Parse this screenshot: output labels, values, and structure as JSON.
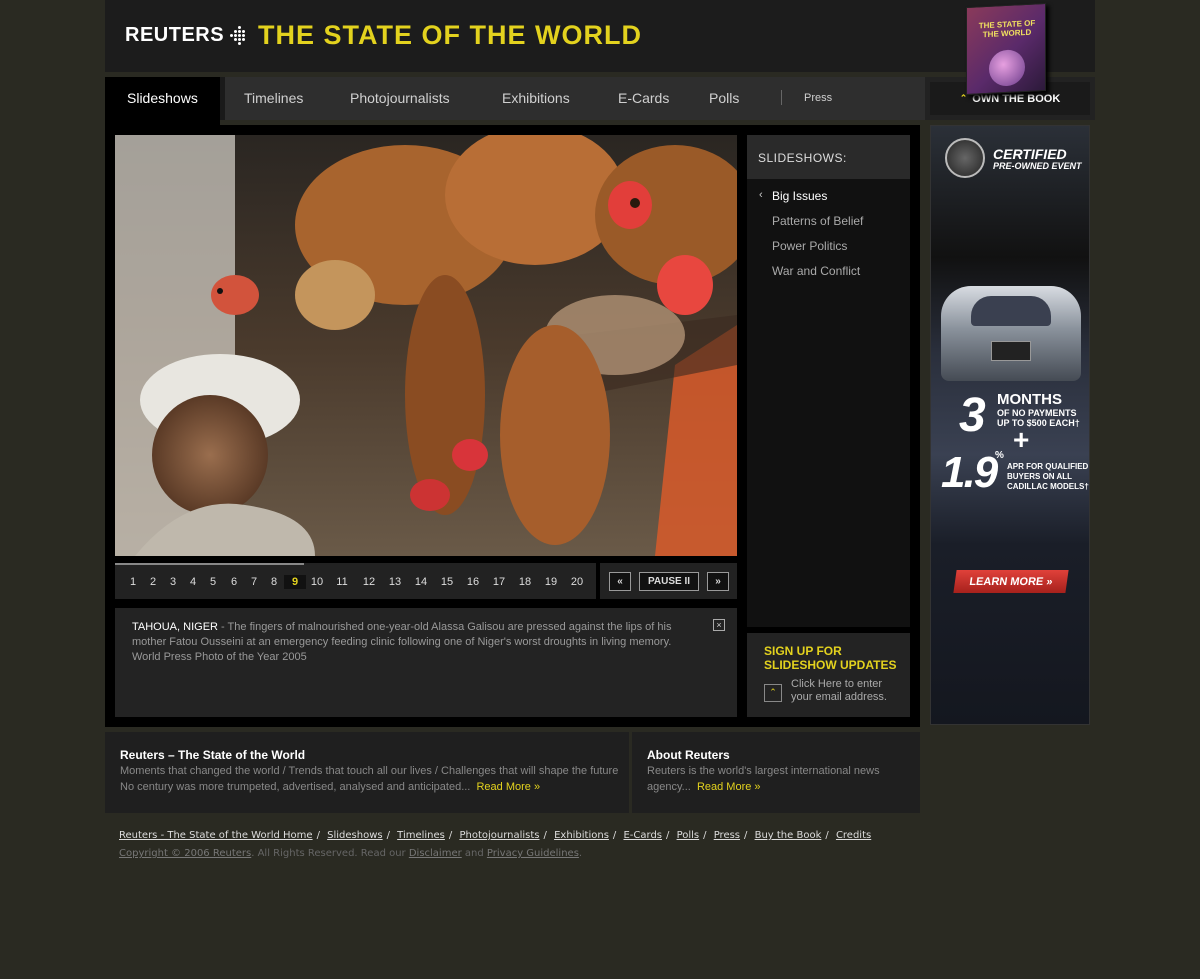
{
  "header": {
    "logo_text": "REUTERS",
    "title": "THE STATE OF THE WORLD",
    "book_cover_text": "THE STATE OF THE WORLD",
    "own_book_label": "OWN THE BOOK"
  },
  "nav": {
    "items": [
      "Slideshows",
      "Timelines",
      "Photojournalists",
      "Exhibitions",
      "E-Cards",
      "Polls"
    ],
    "press_label": "Press",
    "active": "Slideshows"
  },
  "slideshow": {
    "pages": [
      "1",
      "2",
      "3",
      "4",
      "5",
      "6",
      "7",
      "8",
      "9",
      "10",
      "11",
      "12",
      "13",
      "14",
      "15",
      "16",
      "17",
      "18",
      "19",
      "20"
    ],
    "current_page": "9",
    "prev_label": "prev",
    "pause_label": "PAUSE II",
    "next_label": "next",
    "caption_location": "TAHOUA, NIGER",
    "caption_text": " - The fingers of malnourished one-year-old Alassa Galisou are pressed against the lips of his mother Fatou Ousseini at an emergency feeding clinic following one of Niger's worst droughts in living memory.",
    "caption_credit": "World Press Photo of the Year 2005"
  },
  "sidebar": {
    "header": "SLIDESHOWS:",
    "items": [
      "Big Issues",
      "Patterns of Belief",
      "Power Politics",
      "War and Conflict"
    ],
    "active": "Big Issues",
    "signup_title": "SIGN UP FOR SLIDESHOW UPDATES",
    "signup_text": "Click Here to enter your email address."
  },
  "ad": {
    "certified": "CERTIFIED",
    "event": "PRE-OWNED EVENT",
    "big_number": "3",
    "months": "MONTHS",
    "no_payments": "OF NO PAYMENTS UP TO $500 EACH†",
    "plus": "+",
    "rate": "1.9",
    "pct": "%",
    "apr": "APR FOR QUALIFIED BUYERS ON ALL CADILLAC MODELS†",
    "learn_more": "LEARN MORE »"
  },
  "info": {
    "left_title": "Reuters – The State of the World",
    "left_text_1": "Moments that changed the world / Trends that touch all our lives / Challenges that will shape the future",
    "left_text_2": "No century was more trumpeted, advertised, analysed and anticipated...",
    "right_title": "About Reuters",
    "right_text": "Reuters is the world's largest international news agency...",
    "read_more": "Read More »"
  },
  "footer": {
    "links": [
      "Reuters - The State of the World Home",
      "Slideshows",
      "Timelines",
      "Photojournalists",
      "Exhibitions",
      "E-Cards",
      "Polls",
      "Press",
      "Buy the Book",
      "Credits"
    ],
    "copyright_link": "Copyright © 2006 Reuters",
    "copyright_text": ". All Rights Reserved. Read our ",
    "disclaimer": "Disclaimer",
    "and_text": " and ",
    "privacy": "Privacy Guidelines",
    "period": "."
  },
  "colors": {
    "accent_yellow": "#e3d21e",
    "background": "#2a2a22",
    "panel_black": "#000000",
    "ad_red": "#c8302a"
  }
}
